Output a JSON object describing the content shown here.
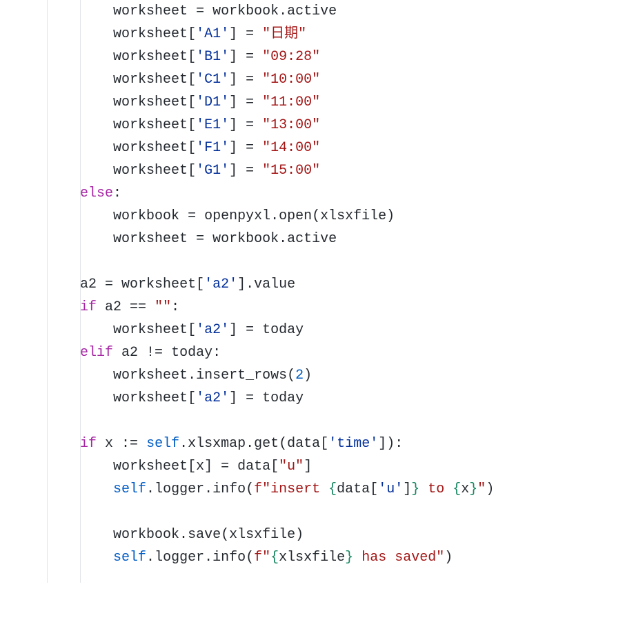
{
  "code": {
    "indent_base": "        ",
    "lines": [
      {
        "n": 1,
        "i": 12,
        "segs": [
          {
            "t": "worksheet ",
            "c": "t-plain"
          },
          {
            "t": "=",
            "c": "t-op"
          },
          {
            "t": " workbook",
            "c": "t-plain"
          },
          {
            "t": ".",
            "c": "t-plain"
          },
          {
            "t": "active",
            "c": "t-plain"
          }
        ]
      },
      {
        "n": 2,
        "i": 12,
        "segs": [
          {
            "t": "worksheet",
            "c": "t-plain"
          },
          {
            "t": "[",
            "c": "t-plain"
          },
          {
            "t": "'A1'",
            "c": "t-bluestr"
          },
          {
            "t": "]",
            "c": "t-plain"
          },
          {
            "t": " ",
            "c": "t-plain"
          },
          {
            "t": "=",
            "c": "t-op"
          },
          {
            "t": " ",
            "c": "t-plain"
          },
          {
            "t": "\"日期\"",
            "c": "t-str"
          }
        ]
      },
      {
        "n": 3,
        "i": 12,
        "segs": [
          {
            "t": "worksheet",
            "c": "t-plain"
          },
          {
            "t": "[",
            "c": "t-plain"
          },
          {
            "t": "'B1'",
            "c": "t-bluestr"
          },
          {
            "t": "]",
            "c": "t-plain"
          },
          {
            "t": " ",
            "c": "t-plain"
          },
          {
            "t": "=",
            "c": "t-op"
          },
          {
            "t": " ",
            "c": "t-plain"
          },
          {
            "t": "\"09:28\"",
            "c": "t-str"
          }
        ]
      },
      {
        "n": 4,
        "i": 12,
        "segs": [
          {
            "t": "worksheet",
            "c": "t-plain"
          },
          {
            "t": "[",
            "c": "t-plain"
          },
          {
            "t": "'C1'",
            "c": "t-bluestr"
          },
          {
            "t": "]",
            "c": "t-plain"
          },
          {
            "t": " ",
            "c": "t-plain"
          },
          {
            "t": "=",
            "c": "t-op"
          },
          {
            "t": " ",
            "c": "t-plain"
          },
          {
            "t": "\"10:00\"",
            "c": "t-str"
          }
        ]
      },
      {
        "n": 5,
        "i": 12,
        "segs": [
          {
            "t": "worksheet",
            "c": "t-plain"
          },
          {
            "t": "[",
            "c": "t-plain"
          },
          {
            "t": "'D1'",
            "c": "t-bluestr"
          },
          {
            "t": "]",
            "c": "t-plain"
          },
          {
            "t": " ",
            "c": "t-plain"
          },
          {
            "t": "=",
            "c": "t-op"
          },
          {
            "t": " ",
            "c": "t-plain"
          },
          {
            "t": "\"11:00\"",
            "c": "t-str"
          }
        ]
      },
      {
        "n": 6,
        "i": 12,
        "segs": [
          {
            "t": "worksheet",
            "c": "t-plain"
          },
          {
            "t": "[",
            "c": "t-plain"
          },
          {
            "t": "'E1'",
            "c": "t-bluestr"
          },
          {
            "t": "]",
            "c": "t-plain"
          },
          {
            "t": " ",
            "c": "t-plain"
          },
          {
            "t": "=",
            "c": "t-op"
          },
          {
            "t": " ",
            "c": "t-plain"
          },
          {
            "t": "\"13:00\"",
            "c": "t-str"
          }
        ]
      },
      {
        "n": 7,
        "i": 12,
        "segs": [
          {
            "t": "worksheet",
            "c": "t-plain"
          },
          {
            "t": "[",
            "c": "t-plain"
          },
          {
            "t": "'F1'",
            "c": "t-bluestr"
          },
          {
            "t": "]",
            "c": "t-plain"
          },
          {
            "t": " ",
            "c": "t-plain"
          },
          {
            "t": "=",
            "c": "t-op"
          },
          {
            "t": " ",
            "c": "t-plain"
          },
          {
            "t": "\"14:00\"",
            "c": "t-str"
          }
        ]
      },
      {
        "n": 8,
        "i": 12,
        "segs": [
          {
            "t": "worksheet",
            "c": "t-plain"
          },
          {
            "t": "[",
            "c": "t-plain"
          },
          {
            "t": "'G1'",
            "c": "t-bluestr"
          },
          {
            "t": "]",
            "c": "t-plain"
          },
          {
            "t": " ",
            "c": "t-plain"
          },
          {
            "t": "=",
            "c": "t-op"
          },
          {
            "t": " ",
            "c": "t-plain"
          },
          {
            "t": "\"15:00\"",
            "c": "t-str"
          }
        ]
      },
      {
        "n": 9,
        "i": 8,
        "segs": [
          {
            "t": "else",
            "c": "t-kw"
          },
          {
            "t": ":",
            "c": "t-plain"
          }
        ]
      },
      {
        "n": 10,
        "i": 12,
        "segs": [
          {
            "t": "workbook ",
            "c": "t-plain"
          },
          {
            "t": "=",
            "c": "t-op"
          },
          {
            "t": " openpyxl",
            "c": "t-plain"
          },
          {
            "t": ".",
            "c": "t-plain"
          },
          {
            "t": "open",
            "c": "t-plain"
          },
          {
            "t": "(",
            "c": "t-plain"
          },
          {
            "t": "xlsxfile",
            "c": "t-plain"
          },
          {
            "t": ")",
            "c": "t-plain"
          }
        ]
      },
      {
        "n": 11,
        "i": 12,
        "segs": [
          {
            "t": "worksheet ",
            "c": "t-plain"
          },
          {
            "t": "=",
            "c": "t-op"
          },
          {
            "t": " workbook",
            "c": "t-plain"
          },
          {
            "t": ".",
            "c": "t-plain"
          },
          {
            "t": "active",
            "c": "t-plain"
          }
        ]
      },
      {
        "n": 12,
        "i": 0,
        "segs": []
      },
      {
        "n": 13,
        "i": 8,
        "segs": [
          {
            "t": "a2 ",
            "c": "t-plain"
          },
          {
            "t": "=",
            "c": "t-op"
          },
          {
            "t": " worksheet",
            "c": "t-plain"
          },
          {
            "t": "[",
            "c": "t-plain"
          },
          {
            "t": "'a2'",
            "c": "t-bluestr"
          },
          {
            "t": "]",
            "c": "t-plain"
          },
          {
            "t": ".",
            "c": "t-plain"
          },
          {
            "t": "value",
            "c": "t-plain"
          }
        ]
      },
      {
        "n": 14,
        "i": 8,
        "segs": [
          {
            "t": "if",
            "c": "t-kw"
          },
          {
            "t": " a2 ",
            "c": "t-plain"
          },
          {
            "t": "==",
            "c": "t-op"
          },
          {
            "t": " ",
            "c": "t-plain"
          },
          {
            "t": "\"\"",
            "c": "t-str"
          },
          {
            "t": ":",
            "c": "t-plain"
          }
        ]
      },
      {
        "n": 15,
        "i": 12,
        "segs": [
          {
            "t": "worksheet",
            "c": "t-plain"
          },
          {
            "t": "[",
            "c": "t-plain"
          },
          {
            "t": "'a2'",
            "c": "t-bluestr"
          },
          {
            "t": "]",
            "c": "t-plain"
          },
          {
            "t": " ",
            "c": "t-plain"
          },
          {
            "t": "=",
            "c": "t-op"
          },
          {
            "t": " today",
            "c": "t-plain"
          }
        ]
      },
      {
        "n": 16,
        "i": 8,
        "segs": [
          {
            "t": "elif",
            "c": "t-kw"
          },
          {
            "t": " a2 ",
            "c": "t-plain"
          },
          {
            "t": "!=",
            "c": "t-op"
          },
          {
            "t": " today:",
            "c": "t-plain"
          }
        ]
      },
      {
        "n": 17,
        "i": 12,
        "segs": [
          {
            "t": "worksheet",
            "c": "t-plain"
          },
          {
            "t": ".",
            "c": "t-plain"
          },
          {
            "t": "insert_rows",
            "c": "t-plain"
          },
          {
            "t": "(",
            "c": "t-plain"
          },
          {
            "t": "2",
            "c": "t-num"
          },
          {
            "t": ")",
            "c": "t-plain"
          }
        ]
      },
      {
        "n": 18,
        "i": 12,
        "segs": [
          {
            "t": "worksheet",
            "c": "t-plain"
          },
          {
            "t": "[",
            "c": "t-plain"
          },
          {
            "t": "'a2'",
            "c": "t-bluestr"
          },
          {
            "t": "]",
            "c": "t-plain"
          },
          {
            "t": " ",
            "c": "t-plain"
          },
          {
            "t": "=",
            "c": "t-op"
          },
          {
            "t": " today",
            "c": "t-plain"
          }
        ]
      },
      {
        "n": 19,
        "i": 0,
        "segs": []
      },
      {
        "n": 20,
        "i": 8,
        "segs": [
          {
            "t": "if",
            "c": "t-kw"
          },
          {
            "t": " x ",
            "c": "t-plain"
          },
          {
            "t": ":=",
            "c": "t-op"
          },
          {
            "t": " ",
            "c": "t-plain"
          },
          {
            "t": "self",
            "c": "t-self"
          },
          {
            "t": ".",
            "c": "t-plain"
          },
          {
            "t": "xlsxmap",
            "c": "t-plain"
          },
          {
            "t": ".",
            "c": "t-plain"
          },
          {
            "t": "get",
            "c": "t-plain"
          },
          {
            "t": "(",
            "c": "t-plain"
          },
          {
            "t": "data",
            "c": "t-plain"
          },
          {
            "t": "[",
            "c": "t-plain"
          },
          {
            "t": "'time'",
            "c": "t-bluestr"
          },
          {
            "t": "]",
            "c": "t-plain"
          },
          {
            "t": ")",
            "c": "t-plain"
          },
          {
            "t": ":",
            "c": "t-plain"
          }
        ]
      },
      {
        "n": 21,
        "i": 12,
        "segs": [
          {
            "t": "worksheet",
            "c": "t-plain"
          },
          {
            "t": "[",
            "c": "t-plain"
          },
          {
            "t": "x",
            "c": "t-plain"
          },
          {
            "t": "]",
            "c": "t-plain"
          },
          {
            "t": " ",
            "c": "t-plain"
          },
          {
            "t": "=",
            "c": "t-op"
          },
          {
            "t": " data",
            "c": "t-plain"
          },
          {
            "t": "[",
            "c": "t-plain"
          },
          {
            "t": "\"u\"",
            "c": "t-str"
          },
          {
            "t": "]",
            "c": "t-plain"
          }
        ]
      },
      {
        "n": 22,
        "i": 12,
        "segs": [
          {
            "t": "self",
            "c": "t-self"
          },
          {
            "t": ".",
            "c": "t-plain"
          },
          {
            "t": "logger",
            "c": "t-plain"
          },
          {
            "t": ".",
            "c": "t-plain"
          },
          {
            "t": "info",
            "c": "t-plain"
          },
          {
            "t": "(",
            "c": "t-plain"
          },
          {
            "t": "f\"insert ",
            "c": "t-str"
          },
          {
            "t": "{",
            "c": "t-fgreen"
          },
          {
            "t": "data[",
            "c": "t-plain"
          },
          {
            "t": "'u'",
            "c": "t-bluestr"
          },
          {
            "t": "]",
            "c": "t-plain"
          },
          {
            "t": "}",
            "c": "t-fgreen"
          },
          {
            "t": " to ",
            "c": "t-str"
          },
          {
            "t": "{",
            "c": "t-fgreen"
          },
          {
            "t": "x",
            "c": "t-plain"
          },
          {
            "t": "}",
            "c": "t-fgreen"
          },
          {
            "t": "\"",
            "c": "t-str"
          },
          {
            "t": ")",
            "c": "t-plain"
          }
        ]
      },
      {
        "n": 23,
        "i": 0,
        "segs": []
      },
      {
        "n": 24,
        "i": 12,
        "segs": [
          {
            "t": "workbook",
            "c": "t-plain"
          },
          {
            "t": ".",
            "c": "t-plain"
          },
          {
            "t": "save",
            "c": "t-plain"
          },
          {
            "t": "(",
            "c": "t-plain"
          },
          {
            "t": "xlsxfile",
            "c": "t-plain"
          },
          {
            "t": ")",
            "c": "t-plain"
          }
        ]
      },
      {
        "n": 25,
        "i": 12,
        "segs": [
          {
            "t": "self",
            "c": "t-self"
          },
          {
            "t": ".",
            "c": "t-plain"
          },
          {
            "t": "logger",
            "c": "t-plain"
          },
          {
            "t": ".",
            "c": "t-plain"
          },
          {
            "t": "info",
            "c": "t-plain"
          },
          {
            "t": "(",
            "c": "t-plain"
          },
          {
            "t": "f\"",
            "c": "t-str"
          },
          {
            "t": "{",
            "c": "t-fgreen"
          },
          {
            "t": "xlsxfile",
            "c": "t-plain"
          },
          {
            "t": "}",
            "c": "t-fgreen"
          },
          {
            "t": " has saved\"",
            "c": "t-str"
          },
          {
            "t": ")",
            "c": "t-plain"
          }
        ]
      }
    ]
  }
}
